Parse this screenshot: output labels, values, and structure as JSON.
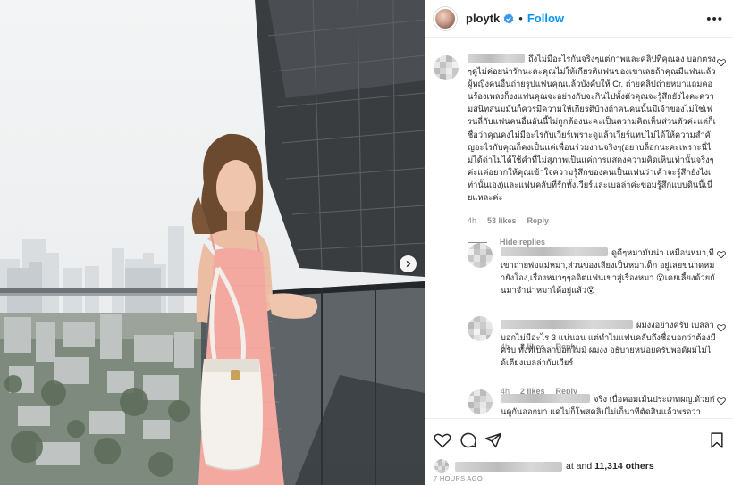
{
  "post": {
    "username": "ploytk",
    "follow_label": "Follow",
    "more_label": "•••"
  },
  "comments": [
    {
      "text": "ถึงไม่มีอะไรกันจริงๆแต่ภาพและคลิปที่คุณลง บอกตรงๆดูไม่ค่อยน่ารักนะคะคุณไม่ให้เกียรติแฟนของเขาเลยถ้าคุณมีแฟนแล้วผู้หญิงคนอื่นถ่ายรูปแฟนคุณแล้วบังคับให้ Cr. ถ่ายคลิปถ่ายหมาแถมคอนร้องเพลงก็งงแฟนคุณจะอย่างกับจะกินไปทั้งตัวคุณจะรู้สึกยังไงคะความสนิทสนมมันก็ควรมีความให้เกียรติบ้างถ้าคนคนนั้นมีเจ้าของไม่ใช่เฟรนลี่กับแฟนคนอื่นอันนี้ไม่ถูกต้องนะคะเป็นความคิดเห็นส่วนตัวค่ะแต่ก็เชื่อว่าคุณคงไม่มีอะไรกับเวียร์เพราะดูแล้วเวียร์แทบไม่ได้ให้ความสำคัญอะไรกับคุณก็คงเป็นแค่เพื่อนร่วมงานจริงๆ(อยาบล็อกนะคะเพราะนี่ไม่ได้ด่าไม่ได้ใช้คำที่ไม่สุภาพเป็นแค่การแสดงความคิดเห็นเท่านั้นจริงๆค่ะแค่อยากให้คุณเข้าใจความรู้สึกของคนเป็นแฟนว่าเค้าจะรู้สึกยังไงเท่านั้นเอง)และแฟนคลับที่รักทั้งเวียร์และเบลล่าค่ะขอมรู้สึกแบบดินนี้เนี่ยแหละค่ะ",
      "time": "4h",
      "likes": "53 likes",
      "reply": "Reply"
    }
  ],
  "hide_replies": "Hide replies",
  "replies": [
    {
      "text": "ดูดีๆหมามันน่า เหมือนหมา,ทีเขาถ่ายพ่อแม่หมา,ส่วนของเสียงเป็นหมาเด็ก อยู่เลยขนาดหมายังโอง,เรื่องหมาๆๆอดิตแฟนเขาสู่เรื่องหมา 😮เคยเลี้ยงด้วยกันมาจำน่าหมาได้อยู่แล้ว😮",
      "time": "4h",
      "likes": "3 likes",
      "reply": "Reply"
    },
    {
      "text": "ผมงงอย่างครับ เบลล่าบอกไม่มีอะไร 3 แน่นอน แต่ทำไมแฟนคลับถึงชื่อบอกว่าต้องมีครับ ทั้งที่เบลล่าบอกไม่มี ผมงง อธิบายหน่อยครับพอดีผมไม่ได้เตียงเบลล่ากับเวียร์",
      "time": "4h",
      "likes": "2 likes",
      "reply": "Reply"
    },
    {
      "text": "จริง เบื่อคอมเม้นประเภทผญ.ด้วยกันดูกันออกมา แค่ไม่ก็โพสคลิปไม่เก็นาทีตัดสินแล้วพรอว่า",
      "time": "",
      "likes": "",
      "reply": ""
    }
  ],
  "likes_line": {
    "mid": "at and",
    "count": "11,314 others"
  },
  "time_ago": "7 HOURS AGO",
  "icons": {
    "verified": "verified-badge-icon",
    "heart": "heart-icon",
    "comment": "comment-icon",
    "share": "paper-plane-icon",
    "save": "bookmark-icon",
    "next": "chevron-right-icon"
  },
  "colors": {
    "accent": "#0095f6",
    "secondary_text": "#8e8e8e",
    "dress": "#f3a9a0"
  }
}
